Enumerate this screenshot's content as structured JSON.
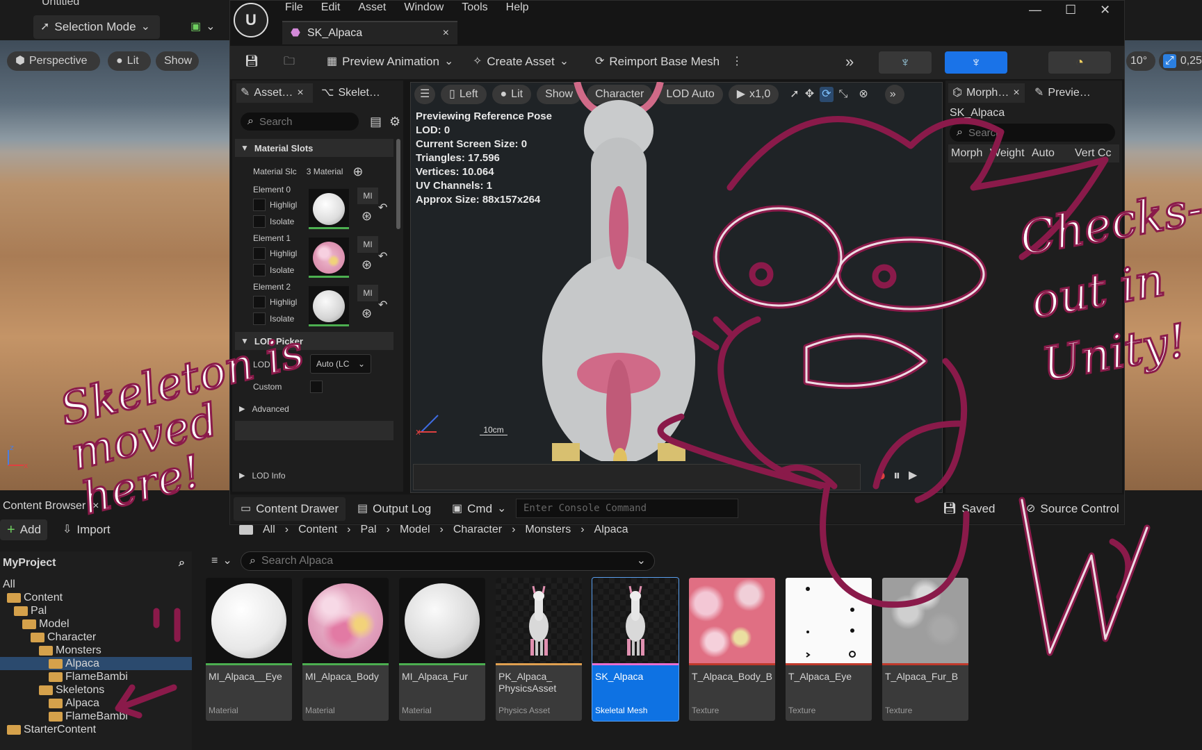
{
  "main_viewport": {
    "selection_mode": "Selection Mode",
    "perspective": "Perspective",
    "lit": "Lit",
    "show": "Show",
    "angle": "10°",
    "scale": "0,25",
    "project_tab": "Untitled"
  },
  "editor": {
    "menu": [
      "File",
      "Edit",
      "Asset",
      "Window",
      "Tools",
      "Help"
    ],
    "asset_tab": "SK_Alpaca",
    "toolbar": {
      "preview_animation": "Preview Animation",
      "create_asset": "Create Asset",
      "reimport": "Reimport Base Mesh"
    },
    "left_tabs": {
      "asset": "Asset…",
      "skeleton": "Skelet…"
    },
    "details": {
      "search_placeholder": "Search",
      "material_slots_header": "Material Slots",
      "material_slots_label": "Material Slc",
      "material_slots_value": "3 Material",
      "elements": [
        {
          "label": "Element 0",
          "highlight": "Highligl",
          "isolate": "Isolate",
          "mi": "MI",
          "color": "#f2f2f2"
        },
        {
          "label": "Element 1",
          "highlight": "Highligl",
          "isolate": "Isolate",
          "mi": "MI",
          "color": "#eebfd2"
        },
        {
          "label": "Element 2",
          "highlight": "Highligl",
          "isolate": "Isolate",
          "mi": "MI",
          "color": "#e5e5e5"
        }
      ],
      "lod_picker_header": "LOD Picker",
      "lod_label": "LOD",
      "lod_value": "Auto (LC",
      "custom_label": "Custom",
      "advanced": "Advanced",
      "lod_info": "LOD Info"
    },
    "viewport": {
      "left": "Left",
      "lit": "Lit",
      "show": "Show",
      "character": "Character",
      "lod": "LOD Auto",
      "speed": "x1,0",
      "info": [
        "Previewing Reference Pose",
        "LOD: 0",
        "Current Screen Size: 0",
        "Triangles: 17.596",
        "Vertices: 10.064",
        "UV Channels: 1",
        "Approx Size: 88x157x264"
      ],
      "scale_label": "10cm"
    },
    "right_tabs": {
      "morph": "Morph…",
      "preview": "Previe…"
    },
    "morph": {
      "asset_name": "SK_Alpaca",
      "search_placeholder": "Search",
      "columns": [
        "Morph",
        "Weight",
        "Auto",
        "Vert Cc"
      ]
    },
    "bottom": {
      "content_drawer": "Content Drawer",
      "output_log": "Output Log",
      "cmd": "Cmd",
      "console_placeholder": "Enter Console Command",
      "saved": "Saved",
      "source_control": "Source Control"
    }
  },
  "content_browser": {
    "tab": "Content Browser",
    "add": "Add",
    "import": "Import",
    "breadcrumb": [
      "All",
      "Content",
      "Pal",
      "Model",
      "Character",
      "Monsters",
      "Alpaca"
    ],
    "project": "MyProject",
    "search_placeholder": "Search Alpaca",
    "tree": [
      {
        "label": "All",
        "depth": 0
      },
      {
        "label": "Content",
        "depth": 1
      },
      {
        "label": "Pal",
        "depth": 2
      },
      {
        "label": "Model",
        "depth": 3
      },
      {
        "label": "Character",
        "depth": 4
      },
      {
        "label": "Monsters",
        "depth": 5
      },
      {
        "label": "Alpaca",
        "depth": 6
      },
      {
        "label": "FlameBambi",
        "depth": 6
      },
      {
        "label": "Skeletons",
        "depth": 5
      },
      {
        "label": "Alpaca",
        "depth": 6
      },
      {
        "label": "FlameBambi",
        "depth": 6
      },
      {
        "label": "StarterContent",
        "depth": 1
      }
    ],
    "assets": [
      {
        "name": "MI_Alpaca__Eye",
        "type": "Material",
        "bar": "#4caf50"
      },
      {
        "name": "MI_Alpaca_Body",
        "type": "Material",
        "bar": "#4caf50"
      },
      {
        "name": "MI_Alpaca_Fur",
        "type": "Material",
        "bar": "#4caf50"
      },
      {
        "name": "PK_Alpaca_ PhysicsAsset",
        "type": "Physics Asset",
        "bar": "#e0a050"
      },
      {
        "name": "SK_Alpaca",
        "type": "Skeletal Mesh",
        "bar": "#e86fd0"
      },
      {
        "name": "T_Alpaca_Body_B",
        "type": "Texture",
        "bar": "#c0392b"
      },
      {
        "name": "T_Alpaca_Eye",
        "type": "Texture",
        "bar": "#c0392b"
      },
      {
        "name": "T_Alpaca_Fur_B",
        "type": "Texture",
        "bar": "#c0392b"
      }
    ]
  },
  "annotations": {
    "skeleton_note": "Skeleton is moved here!",
    "checks_note": "Checks- out in Unity!"
  }
}
